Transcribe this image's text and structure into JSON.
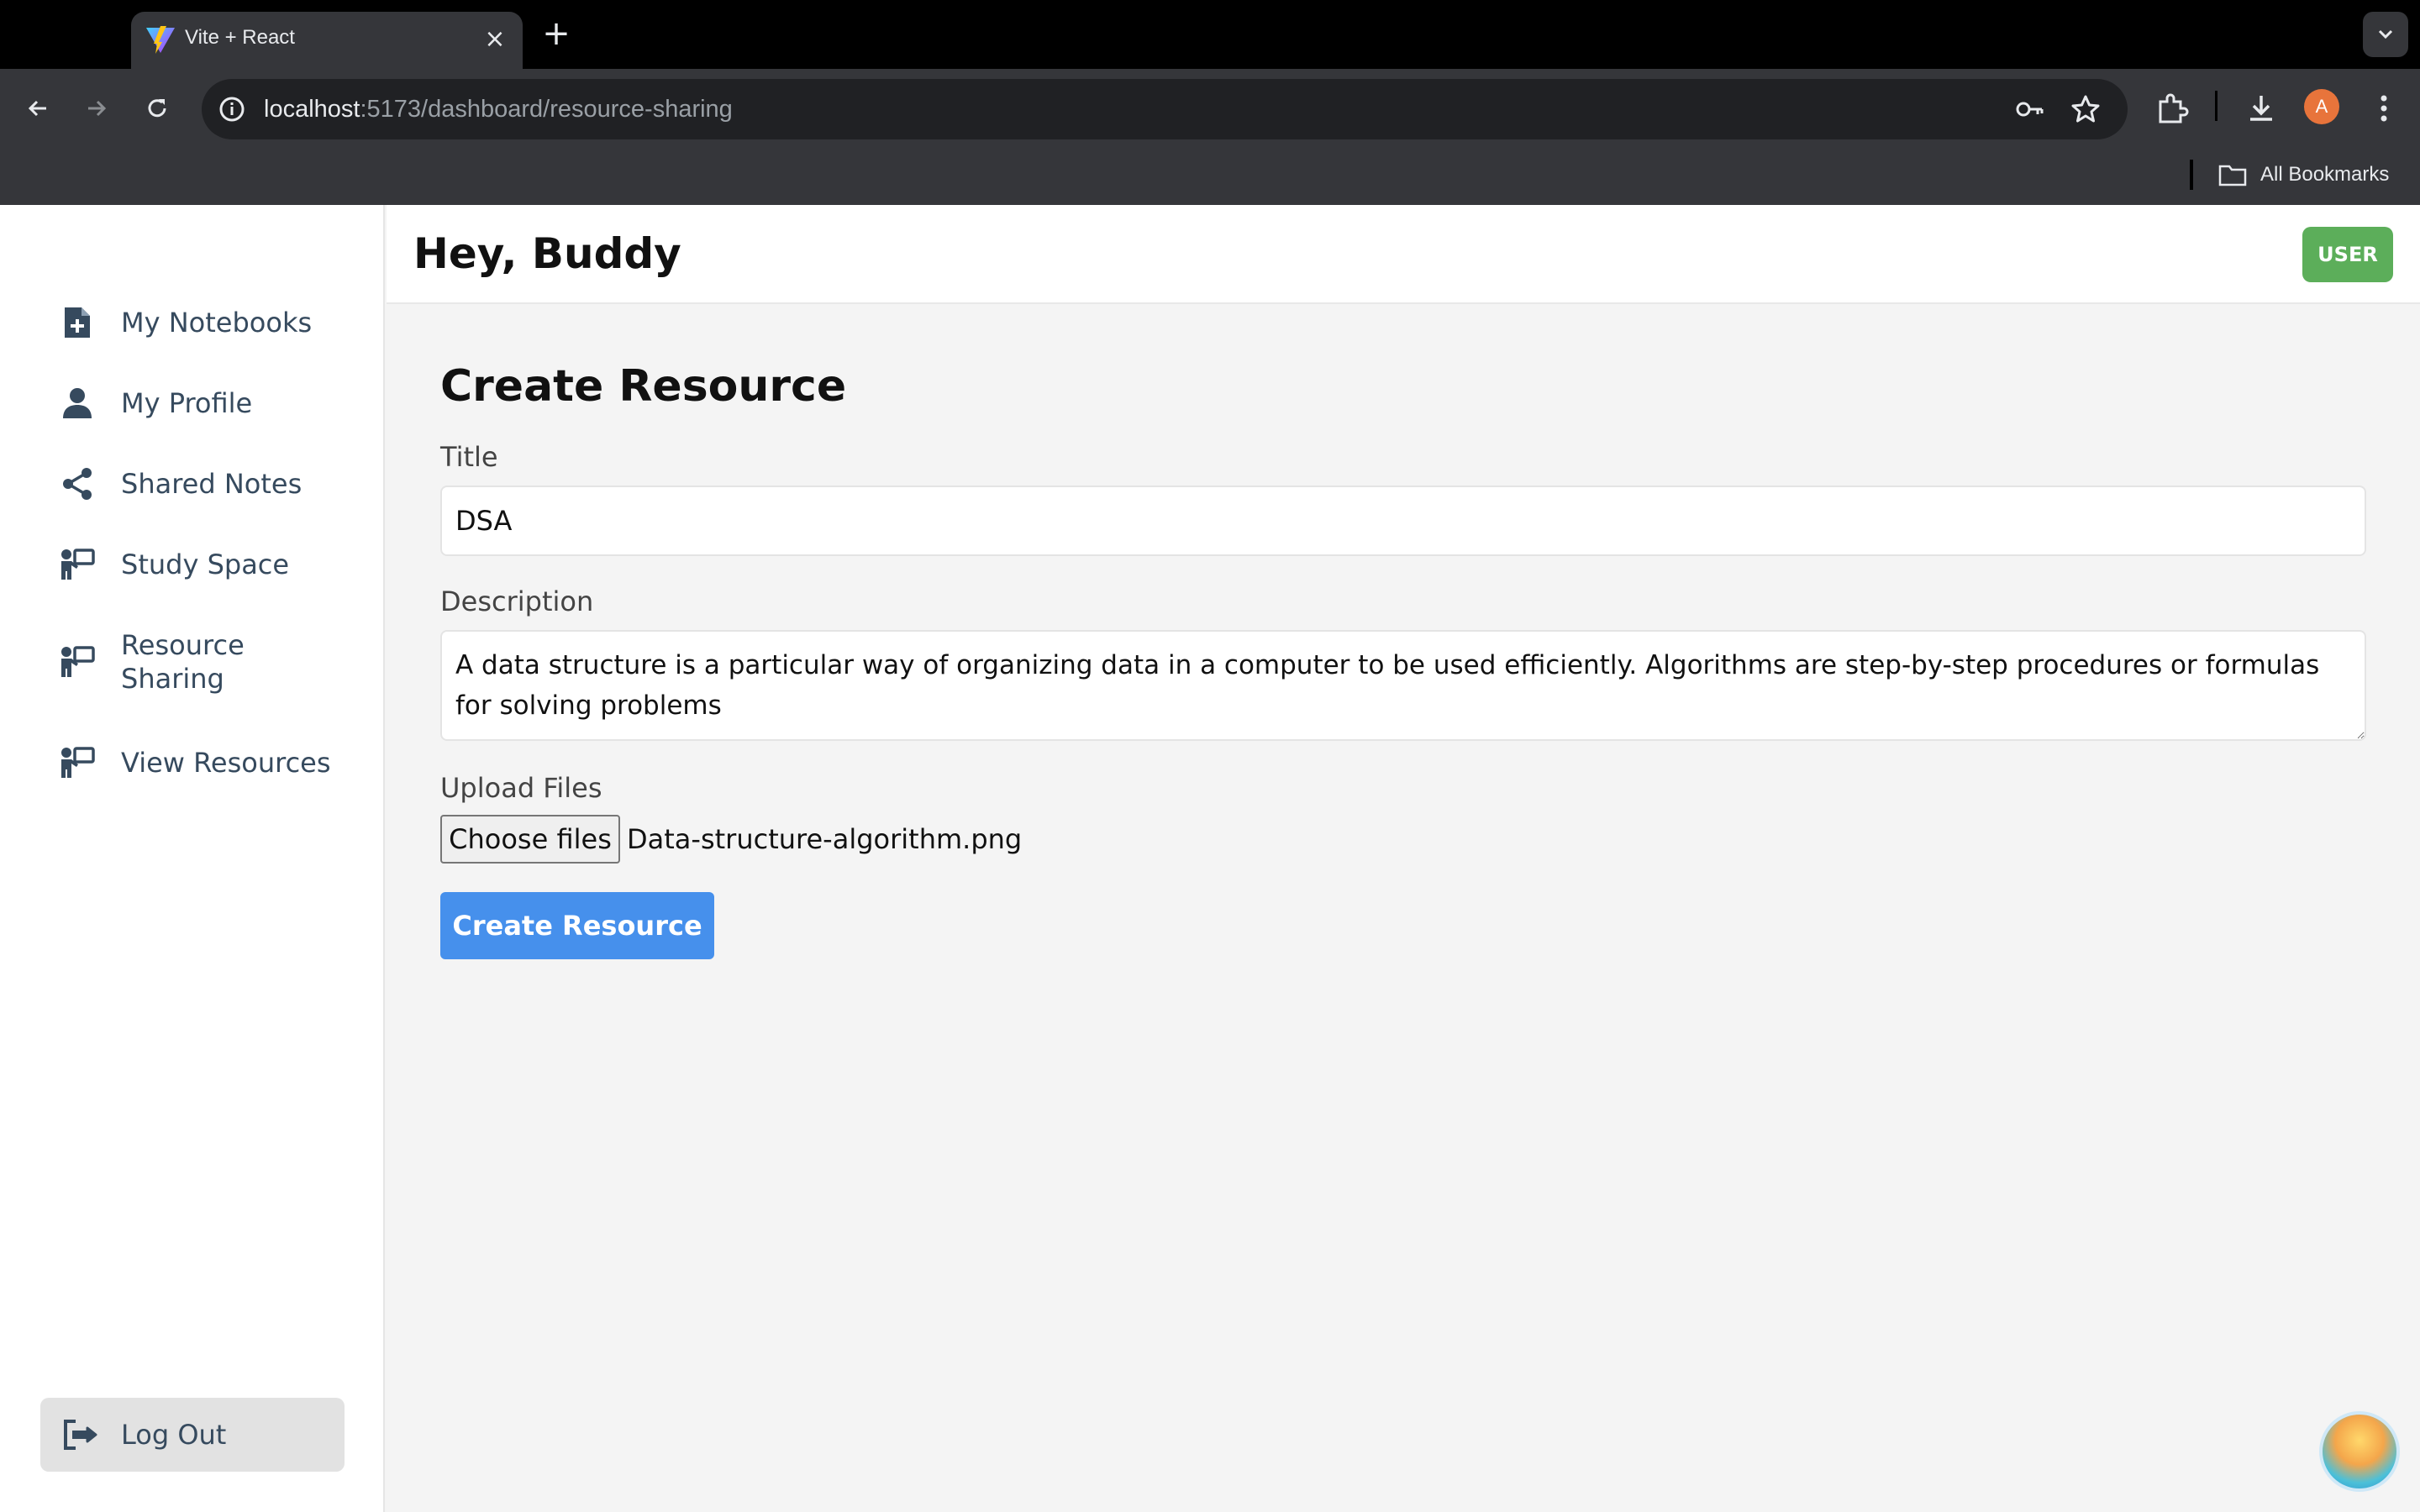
{
  "browser": {
    "tab_title": "Vite + React",
    "url_host": "localhost",
    "url_path": ":5173/dashboard/resource-sharing",
    "profile_initial": "A",
    "bookmarks_label": "All Bookmarks"
  },
  "sidebar": {
    "items": [
      {
        "label": "My Notebooks",
        "icon": "file-plus-icon"
      },
      {
        "label": "My Profile",
        "icon": "user-icon"
      },
      {
        "label": "Shared Notes",
        "icon": "share-icon"
      },
      {
        "label": "Study Space",
        "icon": "presenter-icon"
      },
      {
        "label": "Resource Sharing",
        "icon": "presenter-icon"
      },
      {
        "label": "View Resources",
        "icon": "presenter-icon"
      }
    ],
    "logout_label": "Log Out"
  },
  "header": {
    "greeting": "Hey, Buddy",
    "role_badge": "USER"
  },
  "form": {
    "title": "Create Resource",
    "title_label": "Title",
    "title_value": "DSA",
    "description_label": "Description",
    "description_value": "A data structure is a particular way of organizing data in a computer to be used efficiently. Algorithms are step-by-step procedures or formulas for solving problems",
    "upload_label": "Upload Files",
    "choose_files_label": "Choose files",
    "selected_file": "Data-structure-algorithm.png",
    "submit_label": "Create Resource"
  },
  "colors": {
    "accent": "#4690ec",
    "badge": "#5cae5a",
    "sidebar_text": "#364a5e"
  }
}
